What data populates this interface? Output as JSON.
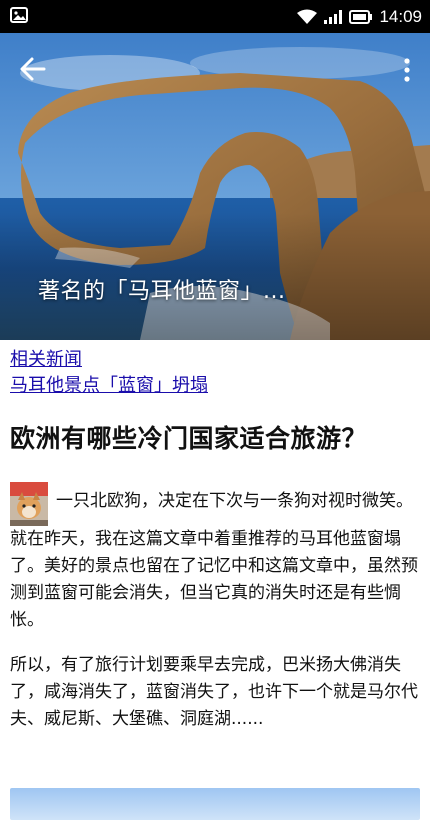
{
  "status_bar": {
    "time": "14:09",
    "icons": [
      "image-notification-icon",
      "wifi-icon",
      "signal-icon",
      "battery-icon"
    ]
  },
  "hero": {
    "caption": "著名的「马耳他蓝窗」...",
    "back_icon": "back-arrow-icon",
    "more_icon": "more-vert-icon"
  },
  "links": {
    "related_news": "相关新闻",
    "headline_link": "马耳他景点「蓝窗」坍塌"
  },
  "article": {
    "title": "欧洲有哪些冷门国家适合旅游？",
    "author_line": "一只北欧狗，决定在下次与一条狗对视时微笑。",
    "paragraphs": [
      "就在昨天，我在这篇文章中着重推荐的马耳他蓝窗塌了。美好的景点也留在了记忆中和这篇文章中，虽然预测到蓝窗可能会消失，但当它真的消失时还是有些惆怅。",
      "所以，有了旅行计划要乘早去完成，巴米扬大佛消失了，咸海消失了，蓝窗消失了，也许下一个就是马尔代夫、威尼斯、大堡礁、洞庭湖......"
    ]
  },
  "colors": {
    "link": "#1a0dab",
    "status_bar_bg": "#000000"
  }
}
